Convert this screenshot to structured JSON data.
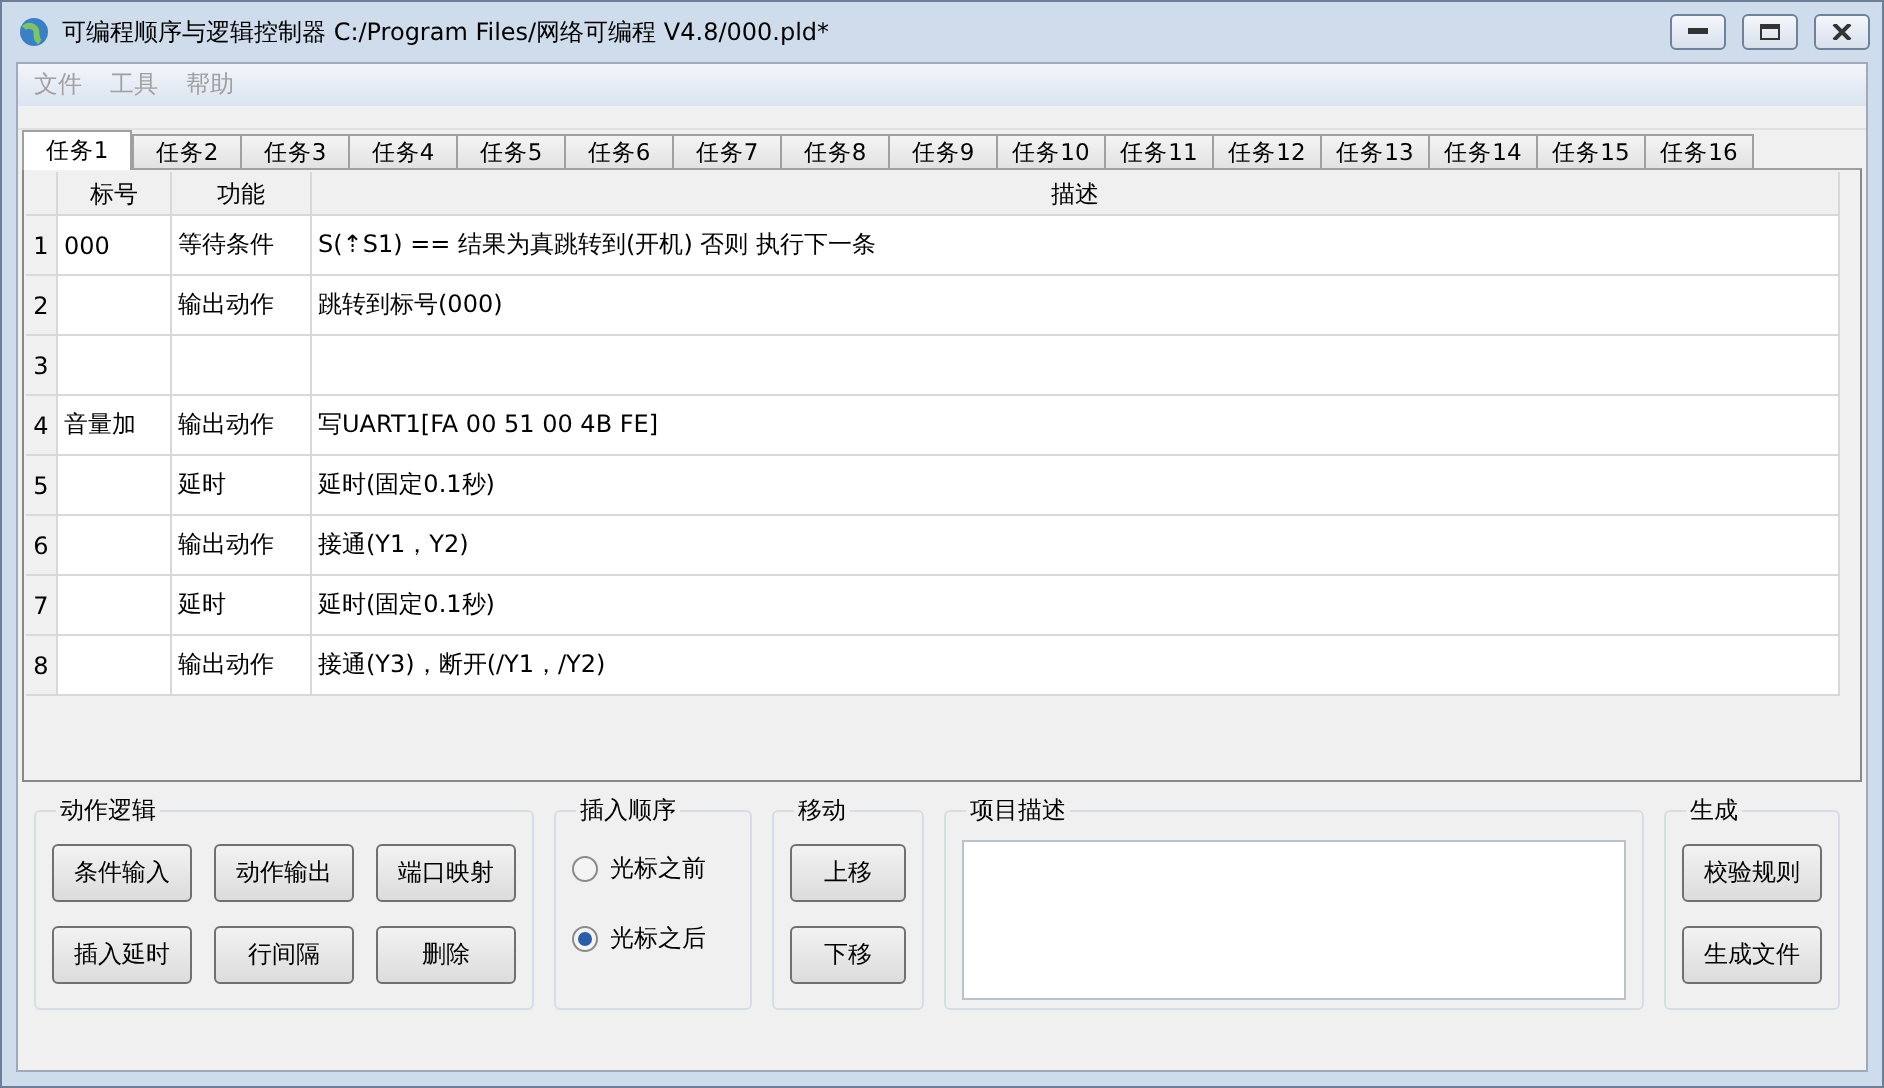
{
  "window": {
    "title": "可编程顺序与逻辑控制器 C:/Program Files/网络可编程 V4.8/000.pld*"
  },
  "menu": [
    {
      "label": "文件",
      "disabled": true
    },
    {
      "label": "工具",
      "disabled": true
    },
    {
      "label": "帮助",
      "disabled": true
    }
  ],
  "tabs": [
    {
      "label": "任务1",
      "selected": true
    },
    {
      "label": "任务2",
      "selected": false
    },
    {
      "label": "任务3",
      "selected": false
    },
    {
      "label": "任务4",
      "selected": false
    },
    {
      "label": "任务5",
      "selected": false
    },
    {
      "label": "任务6",
      "selected": false
    },
    {
      "label": "任务7",
      "selected": false
    },
    {
      "label": "任务8",
      "selected": false
    },
    {
      "label": "任务9",
      "selected": false
    },
    {
      "label": "任务10",
      "selected": false
    },
    {
      "label": "任务11",
      "selected": false
    },
    {
      "label": "任务12",
      "selected": false
    },
    {
      "label": "任务13",
      "selected": false
    },
    {
      "label": "任务14",
      "selected": false
    },
    {
      "label": "任务15",
      "selected": false
    },
    {
      "label": "任务16",
      "selected": false
    }
  ],
  "table": {
    "columns": [
      "标号",
      "功能",
      "描述"
    ],
    "rows": [
      {
        "number": "1",
        "label": "000",
        "function": "等待条件",
        "description": "S(⇡S1)  == 结果为真跳转到(开机)  否则 执行下一条"
      },
      {
        "number": "2",
        "label": "",
        "function": "输出动作",
        "description": "跳转到标号(000)"
      },
      {
        "number": "3",
        "label": "",
        "function": "",
        "description": ""
      },
      {
        "number": "4",
        "label": "音量加",
        "function": "输出动作",
        "description": "写UART1[FA 00 51 00 4B FE]"
      },
      {
        "number": "5",
        "label": "",
        "function": "延时",
        "description": "延时(固定0.1秒)"
      },
      {
        "number": "6",
        "label": "",
        "function": "输出动作",
        "description": "接通(Y1，Y2)"
      },
      {
        "number": "7",
        "label": "",
        "function": "延时",
        "description": "延时(固定0.1秒)"
      },
      {
        "number": "8",
        "label": "",
        "function": "输出动作",
        "description": "接通(Y3)，断开(/Y1，/Y2)"
      }
    ]
  },
  "action_logic": {
    "title": "动作逻辑",
    "buttons": [
      "条件输入",
      "动作输出",
      "端口映射",
      "插入延时",
      "行间隔",
      "删除"
    ]
  },
  "insert_order": {
    "title": "插入顺序",
    "options": [
      {
        "label": "光标之前",
        "selected": false
      },
      {
        "label": "光标之后",
        "selected": true
      }
    ]
  },
  "move": {
    "title": "移动",
    "buttons": [
      "上移",
      "下移"
    ]
  },
  "project_description": {
    "title": "项目描述"
  },
  "generate": {
    "title": "生成",
    "buttons": [
      "校验规则",
      "生成文件"
    ]
  }
}
